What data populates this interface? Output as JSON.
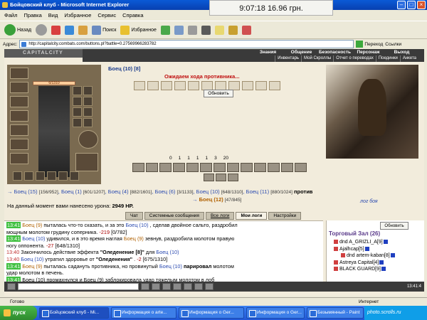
{
  "window": {
    "title": "Бойцовский клуб - Microsoft Internet Explorer",
    "clock": "9:07:18  16.96 грн."
  },
  "menu": [
    "Файл",
    "Правка",
    "Вид",
    "Избранное",
    "Сервис",
    "Справка"
  ],
  "toolbar": {
    "back": "Назад",
    "search": "Поиск",
    "favorites": "Избранное"
  },
  "address": {
    "label": "Адрес:",
    "url": "http://capitalcity.combats.com/buttons.pl?battle=0.27569966283782",
    "go": "Переход",
    "links": "Ссылки"
  },
  "game": {
    "logo": "CAPITALCITY",
    "nav_top": [
      "Знания",
      "Общение",
      "Безопасность",
      "Персонаж",
      "Выход"
    ],
    "nav_sub": [
      "Инвентарь",
      "Мой Скроллы",
      "Отчет о переводах",
      "Поединки",
      "Анкета"
    ],
    "hp": "6/1310",
    "fighter": "Боец (10) [8]",
    "waiting": "Ожидаем хода противника...",
    "refresh": "Обновить",
    "counters": [
      "0",
      "1",
      "1",
      "1",
      "1",
      "3",
      "20"
    ],
    "team_line": {
      "a1": "Боец (15)",
      "a1hp": "[156/952]",
      "a2": "Боец (1)",
      "a2hp": "[601/1207]",
      "a3": "Боец (4)",
      "a3hp": "[882/1601]",
      "a4": "Боец (6)",
      "a4hp": "[3/1133]",
      "a5": "Боец (10)",
      "a5hp": "[648/1310]",
      "a6": "Боец (11)",
      "a6hp": "[880/1024]",
      "vs": "против",
      "e1": "Боец (12)",
      "e1hp": "[47/845]"
    },
    "damage_label": "На данный момент вами нанесено урона:",
    "damage_value": "2949 HP.",
    "logs_link": "лог боя",
    "tabs": [
      "Чат",
      "Системные сообщения",
      "Все логи",
      "Мои логи",
      "Настройки"
    ]
  },
  "log": [
    {
      "time": "13:41",
      "green": true,
      "parts": [
        [
          "no",
          "Боец (9)"
        ],
        [
          "",
          "пыталась что-то сказать, и за это "
        ],
        [
          "nm",
          "Боец (10)"
        ],
        [
          "",
          ", сделав двойное сальто, раздробил"
        ]
      ]
    },
    {
      "time": "",
      "green": false,
      "parts": [
        [
          "",
          "мощным молотом грудину соперника. "
        ],
        [
          "crit",
          "-219"
        ],
        [
          "",
          ""
        ],
        [
          "",
          "  [0/782]"
        ]
      ]
    },
    {
      "time": "13:41",
      "green": true,
      "parts": [
        [
          "nm",
          "Боец (10)"
        ],
        [
          "",
          "удивился, и в это время наглая "
        ],
        [
          "no",
          "Боец (9)"
        ],
        [
          "",
          "зевнув, раздробила молотом правую"
        ]
      ]
    },
    {
      "time": "",
      "green": false,
      "parts": [
        [
          "",
          "ногу оппонента. "
        ],
        [
          "crit",
          "-27"
        ],
        [
          "",
          "  [648/1310]"
        ]
      ]
    },
    {
      "time": "13:40",
      "green": false,
      "parts": [
        [
          "",
          "Закончилось действие эффекта "
        ],
        [
          "bold",
          "\"Оледенение [8]\""
        ],
        [
          "",
          "для "
        ],
        [
          "nm",
          "Боец (10)"
        ]
      ]
    },
    {
      "time": "13:40",
      "green": false,
      "parts": [
        [
          "nm",
          "Боец (10)"
        ],
        [
          "",
          "утратил здоровье от "
        ],
        [
          "bold",
          "\"Оледенения\""
        ],
        [
          "",
          ". "
        ],
        [
          "crit",
          "-2"
        ],
        [
          "",
          "  [675/1310]"
        ]
      ]
    },
    {
      "time": "13:41",
      "green": true,
      "parts": [
        [
          "no",
          "Боец (9)"
        ],
        [
          "",
          "пыталась садануть противника, но провинутый "
        ],
        [
          "nm",
          "Боец (10)"
        ],
        [
          "bold",
          "парировал"
        ],
        [
          "",
          "молотом"
        ]
      ]
    },
    {
      "time": "",
      "green": false,
      "parts": [
        [
          "",
          "удар молотом в печень."
        ]
      ]
    },
    {
      "time": "13:41",
      "green": true,
      "parts": [
        [
          "",
          "Боец (10) промахнулся и Боец (9) заблокировала удар тяжелым молотом в лоб"
        ]
      ]
    }
  ],
  "trade": {
    "refresh": "Обновить",
    "title": "Торговый Зал (26)",
    "members": [
      "dnd A_GRIZLI_A[9]",
      "Ajalhcap[5]",
      "dnd artem-kaban[8]",
      "Astreya Capital[4]",
      "BLACK GUARD[9]"
    ]
  },
  "chat_time": "13:41:4",
  "status": {
    "left": "Готово",
    "zone": "Интернет"
  },
  "taskbar": {
    "start": "пуск",
    "tasks": [
      "Бойцовский клуб - Mi...",
      "Информация о arte...",
      "Информация о Ger...",
      "Информация о Ger...",
      "Безымянный - Paint"
    ],
    "tray": "photo.scrolls.ru"
  }
}
